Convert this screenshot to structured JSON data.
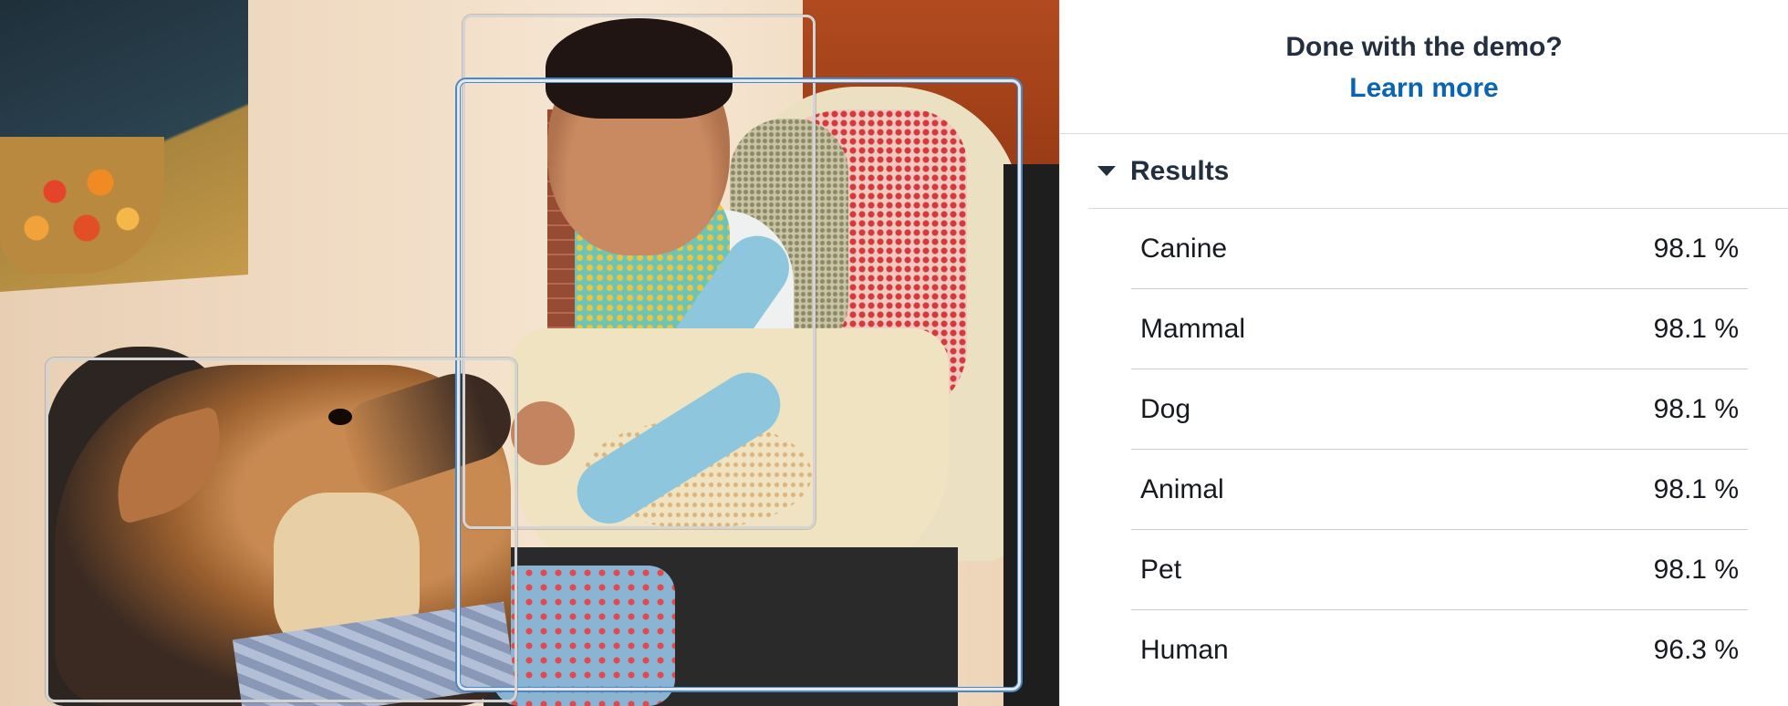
{
  "demo_promo": {
    "title": "Done with the demo?",
    "link_label": "Learn more"
  },
  "results": {
    "header": "Results",
    "collapsed": false,
    "items": [
      {
        "label": "Canine",
        "confidence": "98.1 %"
      },
      {
        "label": "Mammal",
        "confidence": "98.1 %"
      },
      {
        "label": "Dog",
        "confidence": "98.1 %"
      },
      {
        "label": "Animal",
        "confidence": "98.1 %"
      },
      {
        "label": "Pet",
        "confidence": "98.1 %"
      },
      {
        "label": "Human",
        "confidence": "96.3 %"
      }
    ]
  },
  "icons": {
    "results_toggle": "caret-down-icon"
  },
  "colors": {
    "link": "#0a64b4",
    "heading": "#232f3e",
    "divider": "#d5dbdb",
    "bbox_selected": "#4a89c8",
    "bbox_default": "#d4d4d4"
  }
}
